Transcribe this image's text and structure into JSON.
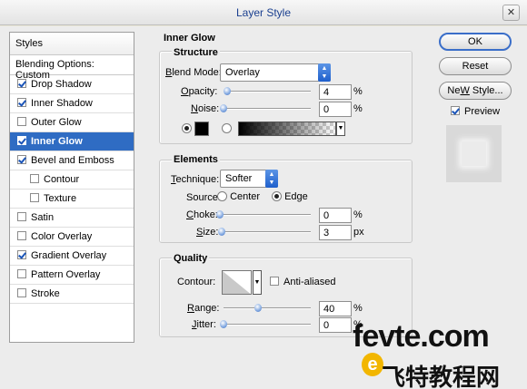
{
  "window": {
    "title": "Layer Style",
    "close_glyph": "✕"
  },
  "styles_list": {
    "header": "Styles",
    "blending_options": "Blending Options: Custom",
    "items": [
      {
        "label": "Drop Shadow",
        "checked": true,
        "sub": false,
        "selected": false
      },
      {
        "label": "Inner Shadow",
        "checked": true,
        "sub": false,
        "selected": false
      },
      {
        "label": "Outer Glow",
        "checked": false,
        "sub": false,
        "selected": false
      },
      {
        "label": "Inner Glow",
        "checked": true,
        "sub": false,
        "selected": true
      },
      {
        "label": "Bevel and Emboss",
        "checked": true,
        "sub": false,
        "selected": false
      },
      {
        "label": "Contour",
        "checked": false,
        "sub": true,
        "selected": false
      },
      {
        "label": "Texture",
        "checked": false,
        "sub": true,
        "selected": false
      },
      {
        "label": "Satin",
        "checked": false,
        "sub": false,
        "selected": false
      },
      {
        "label": "Color Overlay",
        "checked": false,
        "sub": false,
        "selected": false
      },
      {
        "label": "Gradient Overlay",
        "checked": true,
        "sub": false,
        "selected": false
      },
      {
        "label": "Pattern Overlay",
        "checked": false,
        "sub": false,
        "selected": false
      },
      {
        "label": "Stroke",
        "checked": false,
        "sub": false,
        "selected": false
      }
    ]
  },
  "inner_glow": {
    "title": "Inner Glow",
    "structure": {
      "title": "Structure",
      "blend_mode_label_u": "B",
      "blend_mode_label_rest": "lend Mode:",
      "blend_mode_value": "Overlay",
      "opacity_label_u": "O",
      "opacity_label_rest": "pacity:",
      "opacity_value": "4",
      "opacity_level_percent": 4,
      "noise_label_u": "N",
      "noise_label_rest": "oise:",
      "noise_value": "0",
      "noise_level_percent": 0,
      "unit": "%",
      "glow_color": "#000000",
      "color_radio_selected": true,
      "gradient_radio_selected": false
    },
    "elements": {
      "title": "Elements",
      "technique_label_u": "T",
      "technique_label_rest": "echnique:",
      "technique_value": "Softer",
      "source_label": "Source:",
      "source_center": "Center",
      "source_center_selected": false,
      "source_edge": "Edge",
      "source_edge_selected": true,
      "choke_label_u": "C",
      "choke_label_rest": "hoke:",
      "choke_value": "0",
      "choke_unit": "%",
      "choke_level_percent": 0,
      "size_label_u": "S",
      "size_label_rest": "ize:",
      "size_value": "3",
      "size_unit": "px",
      "size_level_percent": 2
    },
    "quality": {
      "title": "Quality",
      "contour_label": "Contour:",
      "anti_aliased_label": "Anti-aliased",
      "anti_aliased_checked": false,
      "range_label_u": "R",
      "range_label_rest": "ange:",
      "range_value": "40",
      "range_unit": "%",
      "range_level_percent": 40,
      "jitter_label_u": "J",
      "jitter_label_rest": "itter:",
      "jitter_value": "0",
      "jitter_unit": "%",
      "jitter_level_percent": 0
    }
  },
  "buttons": {
    "ok": "OK",
    "reset": "Reset",
    "new_style_u": "W",
    "new_style_pre": "Ne",
    "new_style_post": " Style...",
    "preview_label": "Preview",
    "preview_checked": true
  },
  "watermark": {
    "line1": "fevte.com",
    "line2": "飞特教程网",
    "badge": "e"
  }
}
